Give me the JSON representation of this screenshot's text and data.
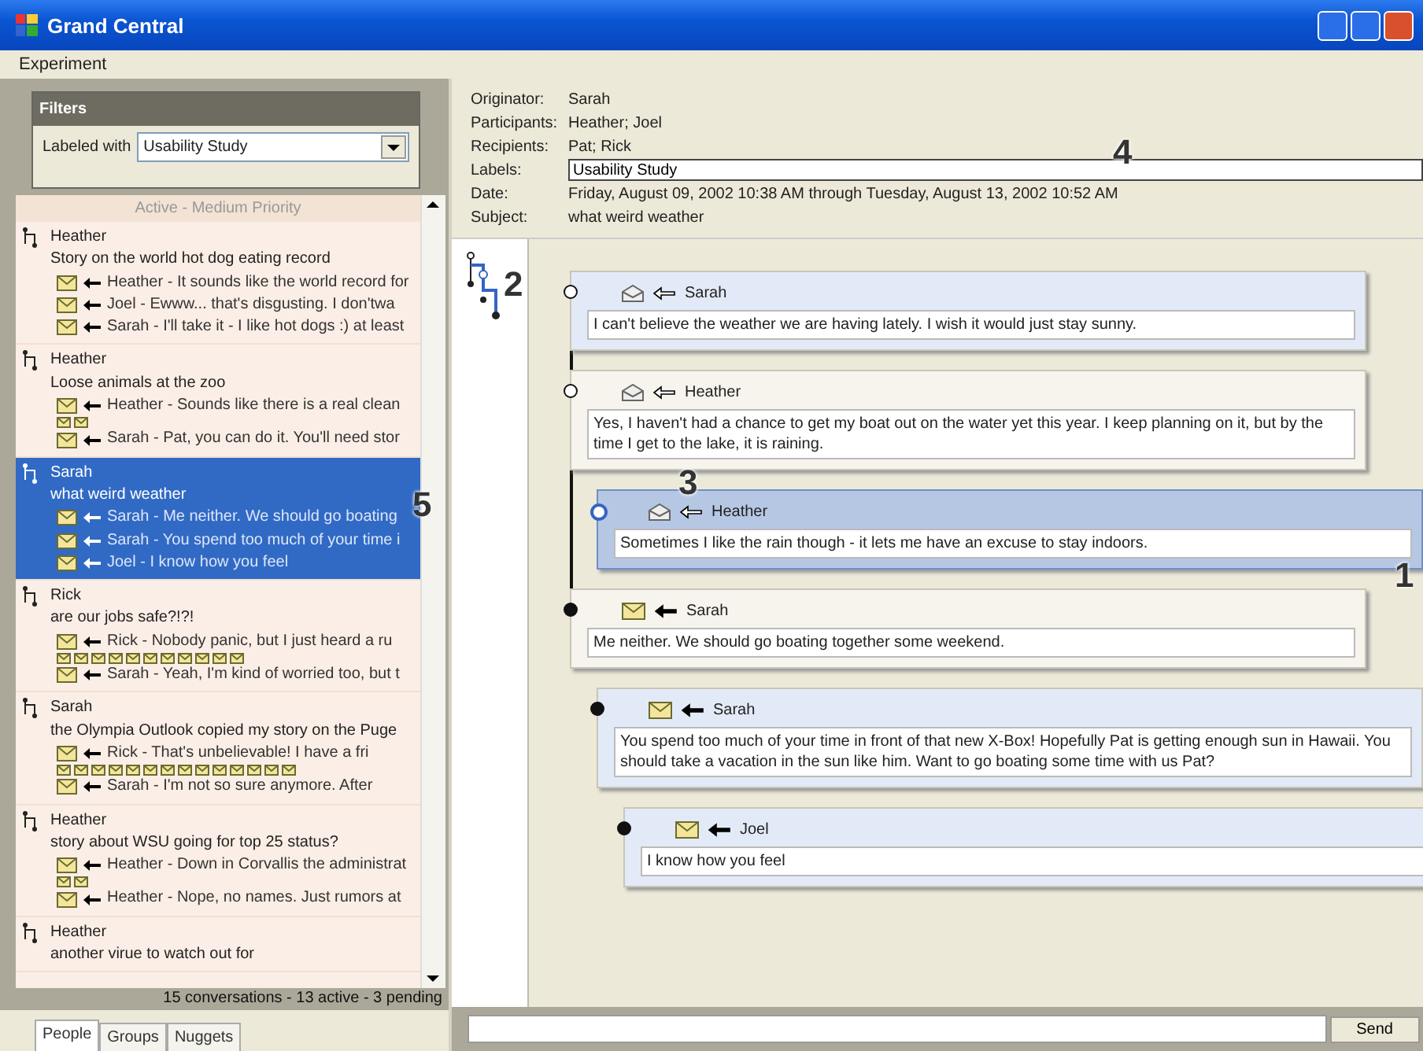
{
  "window": {
    "title": "Grand Central"
  },
  "menu": [
    "Experiment"
  ],
  "filters": {
    "title": "Filters",
    "label": "Labeled with",
    "value": "Usability Study"
  },
  "list": {
    "section": "Active - Medium Priority",
    "status": "15 conversations - 13 active - 3 pending",
    "conversations": [
      {
        "author": "Heather",
        "subject": "Story on the world hot dog eating record",
        "selected": false,
        "lines": [
          {
            "kind": "message",
            "text": "Heather - It sounds like the world record for"
          },
          {
            "kind": "message",
            "text": "Joel - Ewww... that's disgusting.  I don'twa"
          },
          {
            "kind": "message",
            "text": "Sarah - I'll take it - I like hot dogs :) at least"
          }
        ]
      },
      {
        "author": "Heather",
        "subject": "Loose animals at the zoo",
        "selected": false,
        "lines": [
          {
            "kind": "message",
            "text": "Heather - Sounds like there is a real clean"
          },
          {
            "kind": "collapsed",
            "envelopes": [
              {
                "read": false
              },
              {
                "read": false
              }
            ]
          },
          {
            "kind": "message",
            "text": "Sarah - Pat, you can do it.  You'll need stor"
          }
        ]
      },
      {
        "author": "Sarah",
        "subject": "what weird weather",
        "selected": true,
        "lines": [
          {
            "kind": "message",
            "text": "Sarah - Me neither.  We should go boating"
          },
          {
            "kind": "message",
            "text": "Sarah - You spend too much of your time i"
          },
          {
            "kind": "message",
            "text": "Joel - I know how you feel"
          }
        ]
      },
      {
        "author": "Rick",
        "subject": "are our jobs safe?!?!",
        "selected": false,
        "lines": [
          {
            "kind": "message",
            "text": "Rick - Nobody panic, but I just heard a ru"
          },
          {
            "kind": "collapsed",
            "envelopes": [
              {
                "read": false
              },
              {
                "read": false
              },
              {
                "read": false
              },
              {
                "read": false
              },
              {
                "read": false
              },
              {
                "read": false
              },
              {
                "read": false
              },
              {
                "read": false
              },
              {
                "read": false
              },
              {
                "read": false
              },
              {
                "read": false
              }
            ]
          },
          {
            "kind": "message",
            "text": "Sarah - Yeah, I'm kind of worried too, but t"
          }
        ]
      },
      {
        "author": "Sarah",
        "subject": "the Olympia Outlook copied my story on the Puge",
        "selected": false,
        "lines": [
          {
            "kind": "message",
            "text": "Rick - That's unbelievable!  I have a fri"
          },
          {
            "kind": "collapsed",
            "envelopes": [
              {
                "read": false
              },
              {
                "read": false
              },
              {
                "read": false
              },
              {
                "read": false
              },
              {
                "read": false
              },
              {
                "read": false
              },
              {
                "read": false
              },
              {
                "read": false
              },
              {
                "read": false
              },
              {
                "read": false
              },
              {
                "read": false
              },
              {
                "read": false
              },
              {
                "read": false
              },
              {
                "read": false
              }
            ]
          },
          {
            "kind": "message",
            "text": "Sarah - I'm not so sure anymore.  After"
          }
        ]
      },
      {
        "author": "Heather",
        "subject": "story about WSU going for top 25 status?",
        "selected": false,
        "lines": [
          {
            "kind": "message",
            "text": "Heather - Down in Corvallis the administrat"
          },
          {
            "kind": "collapsed",
            "envelopes": [
              {
                "read": false
              },
              {
                "read": false
              }
            ]
          },
          {
            "kind": "message",
            "text": "Heather - Nope, no names.  Just rumors at"
          }
        ]
      },
      {
        "author": "Heather",
        "subject": "another virue to watch out for",
        "selected": false
      }
    ]
  },
  "tabs": [
    {
      "label": "People",
      "selected": true
    },
    {
      "label": "Groups",
      "selected": false
    },
    {
      "label": "Nuggets",
      "selected": false
    }
  ],
  "details": {
    "fields": [
      {
        "kind": "text",
        "label": "Originator:",
        "value": "Sarah"
      },
      {
        "kind": "text",
        "label": "Participants:",
        "value": "Heather; Joel"
      },
      {
        "kind": "text",
        "label": "Recipients:",
        "value": "Pat; Rick"
      },
      {
        "kind": "input",
        "label": "Labels:",
        "value": "Usability Study"
      },
      {
        "kind": "text",
        "label": "Date:",
        "value": "Friday, August 09, 2002 10:38 AM through Tuesday, August 13, 2002 10:52 AM"
      },
      {
        "kind": "text",
        "label": "Subject:",
        "value": "what weird weather"
      }
    ]
  },
  "messages": [
    {
      "sender": "Sarah",
      "read": true,
      "color": "#e3eaf7",
      "selected": false,
      "body": "I can't believe the weather we are having lately.  I wish it would just stay sunny."
    },
    {
      "sender": "Heather",
      "read": true,
      "color": "#f6f4ec",
      "selected": false,
      "body": "Yes, I haven't had a chance to get my boat out on the water yet this year.  I keep planning on it, but by the time I get to the lake, it is raining.",
      "children": [
        {
          "sender": "Heather",
          "read": true,
          "color": "#b6c7e4",
          "selected": true,
          "body": "Sometimes I like the rain though - it lets me have an excuse to stay indoors."
        }
      ]
    },
    {
      "sender": "Sarah",
      "read": false,
      "color": "#f6f4ec",
      "selected": false,
      "body": "Me neither.  We should go boating together some weekend.",
      "children": [
        {
          "sender": "Sarah",
          "read": false,
          "color": "#e3eaf7",
          "selected": false,
          "body": "You spend too much of your time in front of that new X-Box!  Hopefully Pat is getting enough sun in Hawaii.  You should take a vacation in the sun like him.  Want to go boating some time with us Pat?",
          "children": [
            {
              "sender": "Joel",
              "read": false,
              "color": "#e3eaf7",
              "selected": false,
              "body": "I know how you feel"
            }
          ]
        }
      ]
    }
  ],
  "compose": {
    "button": "Send"
  },
  "callouts": [
    "1",
    "2",
    "3",
    "4",
    "5"
  ]
}
